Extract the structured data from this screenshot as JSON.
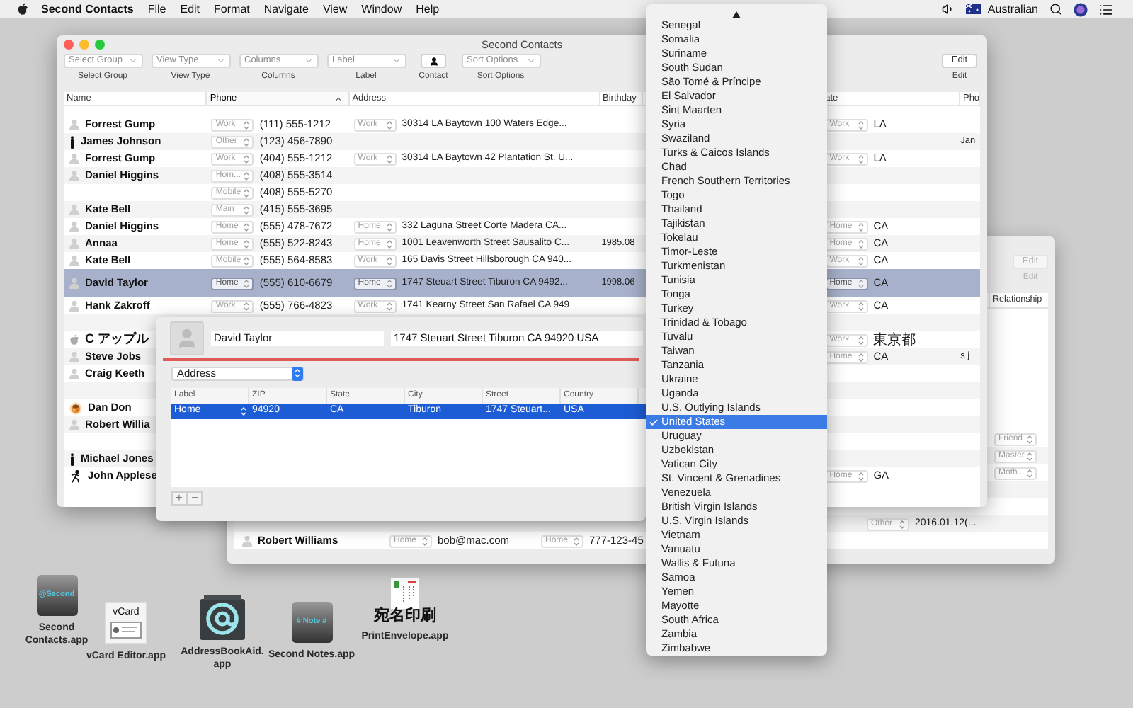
{
  "menu_bar": {
    "app": "Second Contacts",
    "menus": [
      "File",
      "Edit",
      "Format",
      "Navigate",
      "View",
      "Window",
      "Help"
    ],
    "input_source": "Australian"
  },
  "main_window": {
    "title": "Second Contacts",
    "toolbar": [
      {
        "kind": "popup",
        "value": "Select Group",
        "label": "Select Group"
      },
      {
        "kind": "popup",
        "value": "View Type",
        "label": "View Type"
      },
      {
        "kind": "popup",
        "value": "Columns",
        "label": "Columns"
      },
      {
        "kind": "popup",
        "value": "Label",
        "label": "Label"
      },
      {
        "kind": "button",
        "label": "Contact"
      },
      {
        "kind": "popup",
        "value": "Sort Options",
        "label": "Sort Options"
      }
    ],
    "edit": {
      "button": "Edit",
      "label": "Edit",
      "disabled": false
    },
    "columns": [
      {
        "label": "Name",
        "sorted": false
      },
      {
        "label": "Phone",
        "sorted": true
      },
      {
        "label": "Address",
        "sorted": false
      },
      {
        "label": "Birthday",
        "sorted": false
      },
      {
        "label": "ate",
        "sorted": false
      },
      {
        "label": "Pho",
        "sorted": false
      }
    ],
    "rows": [
      {
        "name": "Forrest Gump",
        "avatar": {
          "kind": "placeholder"
        },
        "phone_label": "Work",
        "phone": "(111) 555-1212",
        "address_label": "Work",
        "address": "30314 LA Baytown 100 Waters Edge...",
        "state_label": "Work",
        "state": "LA",
        "selected": false
      },
      {
        "name": "James Johnson",
        "avatar": {
          "kind": "figure"
        },
        "phone_label": "Other",
        "phone": "(123) 456-7890",
        "column_6": "Jan",
        "selected": false
      },
      {
        "name": "Forrest Gump",
        "avatar": {
          "kind": "placeholder"
        },
        "phone_label": "Work",
        "phone": "(404) 555-1212",
        "address_label": "Work",
        "address": "30314 LA Baytown 42 Plantation St. U...",
        "state_label": "Work",
        "state": "LA",
        "selected": false
      },
      {
        "name": "Daniel Higgins",
        "avatar": {
          "kind": "placeholder"
        },
        "phone_label": "Hom...",
        "phone": "(408) 555-3514",
        "selected": false
      },
      {
        "phone_label": "Mobile",
        "phone": "(408) 555-5270",
        "selected": false
      },
      {
        "name": "Kate Bell",
        "avatar": {
          "kind": "placeholder"
        },
        "phone_label": "Main",
        "phone": "(415) 555-3695",
        "selected": false
      },
      {
        "name": "Daniel Higgins",
        "avatar": {
          "kind": "placeholder"
        },
        "phone_label": "Home",
        "phone": "(555) 478-7672",
        "address_label": "Home",
        "address": "332 Laguna Street Corte Madera CA...",
        "state_label": "Home",
        "state": "CA",
        "selected": false
      },
      {
        "name": "Annaa",
        "avatar": {
          "kind": "placeholder"
        },
        "phone_label": "Home",
        "phone": "(555) 522-8243",
        "address_label": "Home",
        "address": "1001  Leavenworth Street Sausalito C...",
        "birthday": "1985.08",
        "state_label": "Home",
        "state": "CA",
        "selected": false
      },
      {
        "name": "Kate Bell",
        "avatar": {
          "kind": "placeholder"
        },
        "phone_label": "Mobile",
        "phone": "(555) 564-8583",
        "address_label": "Work",
        "address": "165 Davis Street Hillsborough CA 940...",
        "state_label": "Work",
        "state": "CA",
        "selected": false
      },
      {
        "name": "David Taylor",
        "avatar": {
          "kind": "placeholder"
        },
        "phone_label": "Home",
        "phone": "(555) 610-6679",
        "address_label": "Home",
        "address": "1747 Steuart Street Tiburon CA 9492...",
        "birthday": "1998.06",
        "state_label": "Home",
        "state": "CA",
        "selected": true
      },
      {
        "name": "Hank Zakroff",
        "avatar": {
          "kind": "placeholder"
        },
        "phone_label": "Work",
        "phone": "(555) 766-4823",
        "address_label": "Work",
        "address": "1741 Kearny Street San Rafael CA 949",
        "state_label": "Work",
        "state": "CA",
        "selected": false
      },
      {
        "selected": false
      },
      {
        "name": "C アップル",
        "avatar": {
          "kind": "apple"
        },
        "state_label": "Work",
        "state": "東京都",
        "selected": false
      },
      {
        "name": "Steve Jobs",
        "avatar": {
          "kind": "placeholder"
        },
        "state_label": "Home",
        "state": "CA",
        "column_6": "s j",
        "selected": false
      },
      {
        "name": "Craig Keeth",
        "avatar": {
          "kind": "placeholder"
        },
        "selected": false
      },
      {
        "selected": false
      },
      {
        "name": "Dan Don",
        "selected": false
      },
      {
        "name": "Robert Willia",
        "avatar": {
          "kind": "placeholder"
        },
        "selected": false
      },
      {
        "selected": false
      },
      {
        "name": "Michael Jones",
        "avatar": {
          "kind": "figure"
        },
        "selected": false
      },
      {
        "name": "John Applese",
        "avatar": {
          "kind": "runner"
        },
        "state_label": "Home",
        "state": "GA",
        "selected": false
      }
    ]
  },
  "back_window": {
    "edit": {
      "button": "Edit",
      "label": "Edit",
      "disabled": true
    },
    "column": "Relationship",
    "rows": [
      {
        "relationship": "Friend"
      },
      {
        "relationship": "Master"
      },
      {
        "relationship": "Moth..."
      },
      {},
      {},
      {
        "date_label": "Other",
        "date": "2016.01.12(..."
      },
      {
        "name": "Robert Williams",
        "avatar": {
          "kind": "placeholder"
        },
        "email_label": "Home",
        "email": "bob@mac.com",
        "phone_label": "Home",
        "phone": "777-123-45"
      }
    ]
  },
  "detail": {
    "name": "David Taylor",
    "address": "1747 Steuart Street Tiburon CA 94920 USA",
    "field_type": "Address",
    "columns": [
      "Label",
      "ZIP",
      "State",
      "City",
      "Street",
      "Country"
    ],
    "rows": [
      {
        "cells": [
          "Home",
          "94920",
          "CA",
          "Tiburon",
          "1747 Steuart...",
          "USA"
        ],
        "selected": true
      }
    ],
    "buttons": [
      "+",
      "−"
    ]
  },
  "country_menu": [
    {
      "label": "Senegal",
      "selected": false
    },
    {
      "label": "Somalia",
      "selected": false
    },
    {
      "label": "Suriname",
      "selected": false
    },
    {
      "label": "South Sudan",
      "selected": false
    },
    {
      "label": "São Tomé & Príncipe",
      "selected": false
    },
    {
      "label": "El Salvador",
      "selected": false
    },
    {
      "label": "Sint Maarten",
      "selected": false
    },
    {
      "label": "Syria",
      "selected": false
    },
    {
      "label": "Swaziland",
      "selected": false
    },
    {
      "label": "Turks & Caicos Islands",
      "selected": false
    },
    {
      "label": "Chad",
      "selected": false
    },
    {
      "label": "French Southern Territories",
      "selected": false
    },
    {
      "label": "Togo",
      "selected": false
    },
    {
      "label": "Thailand",
      "selected": false
    },
    {
      "label": "Tajikistan",
      "selected": false
    },
    {
      "label": "Tokelau",
      "selected": false
    },
    {
      "label": "Timor-Leste",
      "selected": false
    },
    {
      "label": "Turkmenistan",
      "selected": false
    },
    {
      "label": "Tunisia",
      "selected": false
    },
    {
      "label": "Tonga",
      "selected": false
    },
    {
      "label": "Turkey",
      "selected": false
    },
    {
      "label": "Trinidad & Tobago",
      "selected": false
    },
    {
      "label": "Tuvalu",
      "selected": false
    },
    {
      "label": "Taiwan",
      "selected": false
    },
    {
      "label": "Tanzania",
      "selected": false
    },
    {
      "label": "Ukraine",
      "selected": false
    },
    {
      "label": "Uganda",
      "selected": false
    },
    {
      "label": "U.S. Outlying Islands",
      "selected": false
    },
    {
      "label": "United States",
      "selected": true
    },
    {
      "label": "Uruguay",
      "selected": false
    },
    {
      "label": "Uzbekistan",
      "selected": false
    },
    {
      "label": "Vatican City",
      "selected": false
    },
    {
      "label": "St. Vincent & Grenadines",
      "selected": false
    },
    {
      "label": "Venezuela",
      "selected": false
    },
    {
      "label": "British Virgin Islands",
      "selected": false
    },
    {
      "label": "U.S. Virgin Islands",
      "selected": false
    },
    {
      "label": "Vietnam",
      "selected": false
    },
    {
      "label": "Vanuatu",
      "selected": false
    },
    {
      "label": "Wallis & Futuna",
      "selected": false
    },
    {
      "label": "Samoa",
      "selected": false
    },
    {
      "label": "Yemen",
      "selected": false
    },
    {
      "label": "Mayotte",
      "selected": false
    },
    {
      "label": "South Africa",
      "selected": false
    },
    {
      "label": "Zambia",
      "selected": false
    },
    {
      "label": "Zimbabwe",
      "selected": false
    }
  ],
  "desktop_icons": [
    {
      "kind": "contacts",
      "icon_text": "@Second",
      "label": "Second Contacts.app"
    },
    {
      "kind": "vcard",
      "icon_text": "vCard",
      "label": "vCard Editor.app"
    },
    {
      "kind": "at",
      "label": "AddressBookAid.app"
    },
    {
      "kind": "note",
      "icon_text": "# Note #",
      "label": "Second Notes.app"
    },
    {
      "kind": "envelope",
      "icon_text": "宛名印刷",
      "label": "PrintEnvelope.app"
    }
  ]
}
